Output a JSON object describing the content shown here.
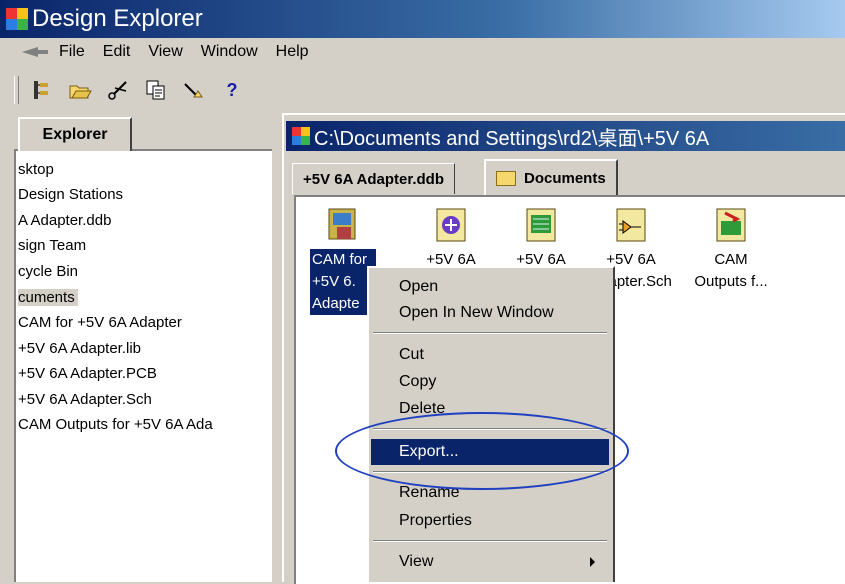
{
  "window": {
    "title": "Design Explorer"
  },
  "menubar": {
    "items": [
      "File",
      "Edit",
      "View",
      "Window",
      "Help"
    ]
  },
  "toolbar": {
    "buttons": [
      "explorer-tree-icon",
      "open-folder-icon",
      "cut-icon",
      "copy-icon",
      "paste-icon"
    ],
    "help_label": "?"
  },
  "explorer": {
    "tab_label": "Explorer",
    "tree_items": [
      "sktop",
      "Design Stations",
      "A Adapter.ddb",
      "sign Team",
      "cycle Bin",
      "cuments",
      "CAM for +5V 6A Adapter",
      "+5V 6A Adapter.lib",
      "+5V 6A Adapter.PCB",
      "+5V 6A Adapter.Sch",
      "CAM Outputs for +5V 6A Ada"
    ]
  },
  "document": {
    "title": "C:\\Documents and Settings\\rd2\\桌面\\+5V 6A",
    "tabs": [
      "+5V 6A Adapter.ddb",
      "Documents"
    ],
    "icons": [
      {
        "line1": "CAM for",
        "line2": "+5V 6.",
        "line3": "Adapte"
      },
      {
        "line1": "+5V 6A",
        "line2": "",
        "line3": ""
      },
      {
        "line1": "+5V 6A",
        "line2": "",
        "line3": ""
      },
      {
        "line1": "+5V 6A",
        "line2": "Adapter.Sch",
        "line3": ""
      },
      {
        "line1": "CAM",
        "line2": "Outputs f...",
        "line3": ""
      }
    ]
  },
  "context_menu": {
    "open": "Open",
    "open_new_window": "Open In New Window",
    "cut": "Cut",
    "copy": "Copy",
    "delete": "Delete",
    "export": "Export...",
    "rename": "Rename",
    "properties": "Properties",
    "view": "View"
  },
  "colors": {
    "titlebar": "#0a246a",
    "highlight": "#0a246a",
    "annotation_ellipse": "#2040c0"
  }
}
